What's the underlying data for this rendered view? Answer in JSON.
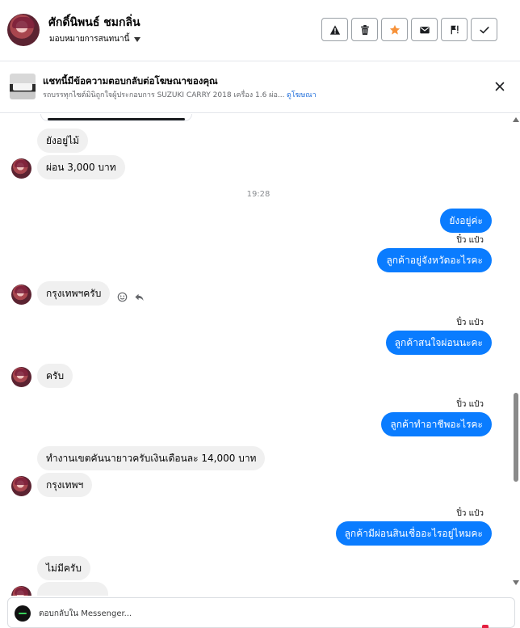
{
  "header": {
    "contact_name": "ศักดิ์นิพนธ์ ชมกลิ่น",
    "assign_label": "มอบหมายการสนทนานี้",
    "actions": [
      {
        "name": "report-spam-button",
        "icon": "warning-icon"
      },
      {
        "name": "delete-button",
        "icon": "trash-icon"
      },
      {
        "name": "star-button",
        "icon": "star-icon"
      },
      {
        "name": "mark-unread-button",
        "icon": "envelope-icon"
      },
      {
        "name": "follow-up-button",
        "icon": "flag-alert-icon"
      },
      {
        "name": "mark-done-button",
        "icon": "check-icon"
      }
    ],
    "accent_star": "#f7923a"
  },
  "ad": {
    "title": "แชทนี้มีข้อความตอบกลับต่อโฆษณาของคุณ",
    "subtitle": "รถบรรทุกไซต์มินิถูกใจผู้ประกอบการ SUZUKI CARRY 2018 เครื่อง 1.6 ผ่อ...",
    "link_text": "ดูโฆษณา"
  },
  "chat": {
    "time_label": "19:28",
    "seen_label": "ปิ๋ว แป๋ว",
    "messages": {
      "m1": "ยังอยู่ไม้",
      "m2": "ผ่อน 3,000 บาท",
      "m3": "ยังอยู่ค่ะ",
      "m4": "ลูกค้าอยู่จังหวัดอะไรคะ",
      "m5": "กรุงเทพฯครับ",
      "m6": "ลูกค้าสนใจผ่อนนะคะ",
      "m7": "ครับ",
      "m8": "ลูกค้าทำอาชีพอะไรคะ",
      "m9": "ทำงานเขตคันนายาวครับเงินเดือนละ 14,000 บาท",
      "m10": "กรุงเทพฯ",
      "m11": "ลูกค้ามีผ่อนสินเชื่ออะไรอยู่ไหมคะ",
      "m12": "ไม่มีครับ"
    },
    "incoming_color": "#f0f0f0",
    "outgoing_color": "#0a7cff"
  },
  "composer": {
    "placeholder": "ตอบกลับใน Messenger..."
  }
}
